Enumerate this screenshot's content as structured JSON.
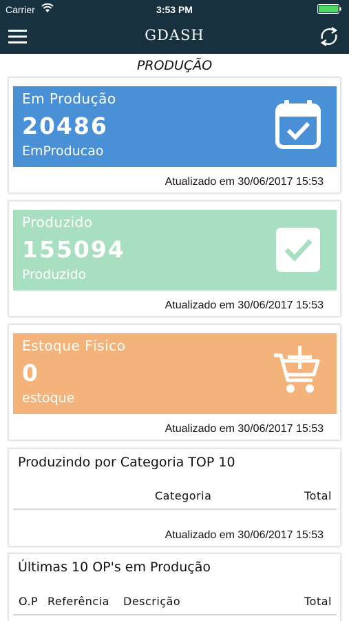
{
  "status_bar": {
    "carrier": "Carrier",
    "time": "3:53 PM"
  },
  "nav": {
    "title": "GDASH"
  },
  "section_title": "PRODUÇÃO",
  "tiles": [
    {
      "title": "Em Produção",
      "value": "20486",
      "subtitle": "EmProducao",
      "updated": "Atualizado em 30/06/2017 15:53",
      "color": "#4a90d6",
      "icon": "calendar-check-icon"
    },
    {
      "title": "Produzido",
      "value": "155094",
      "subtitle": "Produzido",
      "updated": "Atualizado em 30/06/2017 15:53",
      "color": "#a8dfc0",
      "icon": "checkbox-icon"
    },
    {
      "title": "Estoque Físico",
      "value": "0",
      "subtitle": "estoque",
      "updated": "Atualizado em 30/06/2017 15:53",
      "color": "#f4b37a",
      "icon": "cart-add-icon"
    }
  ],
  "category_card": {
    "title": "Produzindo por Categoria TOP 10",
    "columns": [
      "Categoria",
      "Total"
    ],
    "updated": "Atualizado em 30/06/2017 15:53"
  },
  "op_card": {
    "title": "Últimas 10 OP's em Produção",
    "columns": [
      "O.P",
      "Referência",
      "Descrição",
      "Total"
    ]
  }
}
